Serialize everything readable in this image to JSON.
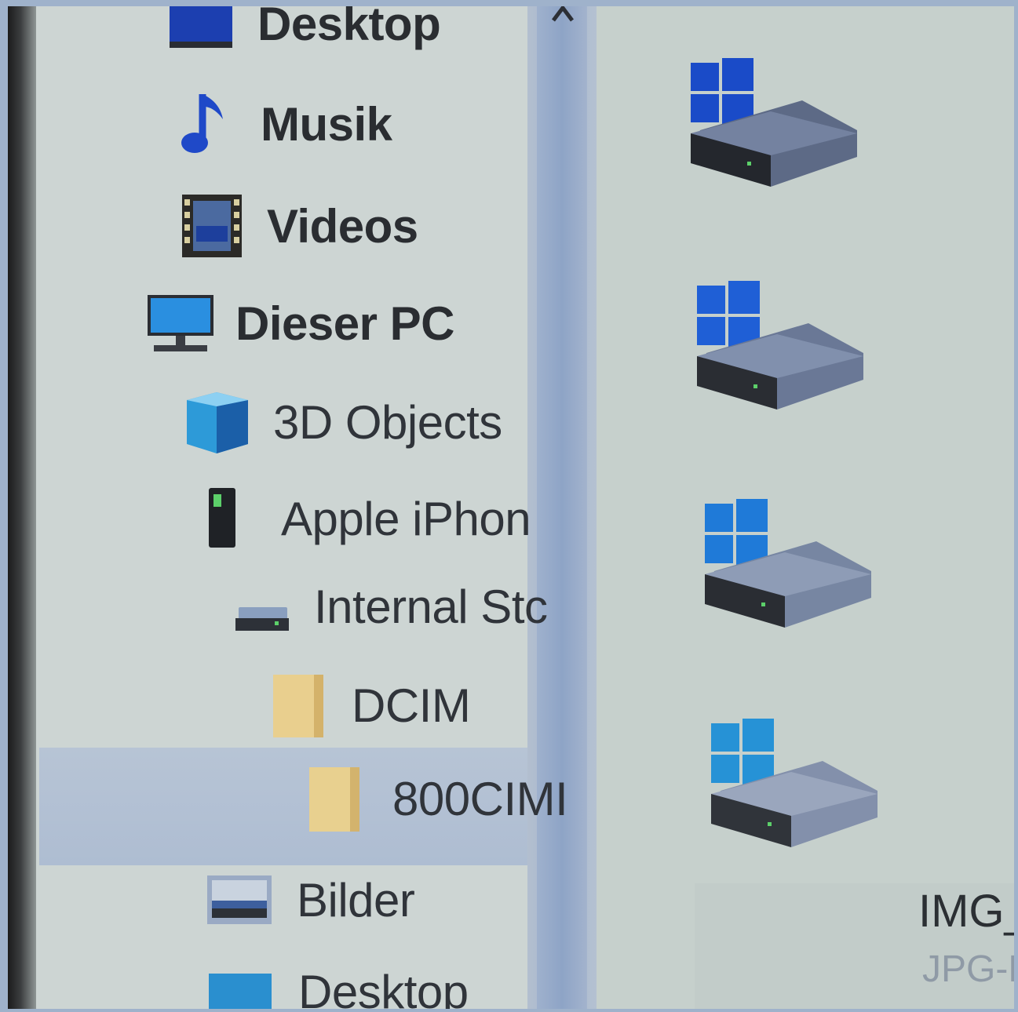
{
  "nav": {
    "items": [
      {
        "label": "Desktop",
        "icon": "desktop-folder-icon"
      },
      {
        "label": "Musik",
        "icon": "music-note-icon"
      },
      {
        "label": "Videos",
        "icon": "video-film-icon"
      },
      {
        "label": "Dieser PC",
        "icon": "monitor-icon"
      },
      {
        "label": "3D Objects",
        "icon": "cube-3d-icon"
      },
      {
        "label": "Apple iPhon",
        "icon": "phone-icon"
      },
      {
        "label": "Internal Stc",
        "icon": "drive-icon"
      },
      {
        "label": "DCIM",
        "icon": "folder-icon"
      },
      {
        "label": "800CIMI",
        "icon": "folder-icon",
        "selected": true
      },
      {
        "label": "Bilder",
        "icon": "pictures-folder-icon"
      },
      {
        "label": "Desktop",
        "icon": "desktop-folder-icon"
      }
    ]
  },
  "content": {
    "drives": [
      "windows-drive-icon",
      "windows-drive-icon",
      "windows-drive-icon",
      "windows-drive-icon"
    ],
    "file": {
      "name": "IMG_",
      "type": "JPG-D"
    }
  },
  "colors": {
    "accent": "#1e5fd0",
    "selection": "#b1bfd3",
    "folder": "#e9cf8e"
  }
}
